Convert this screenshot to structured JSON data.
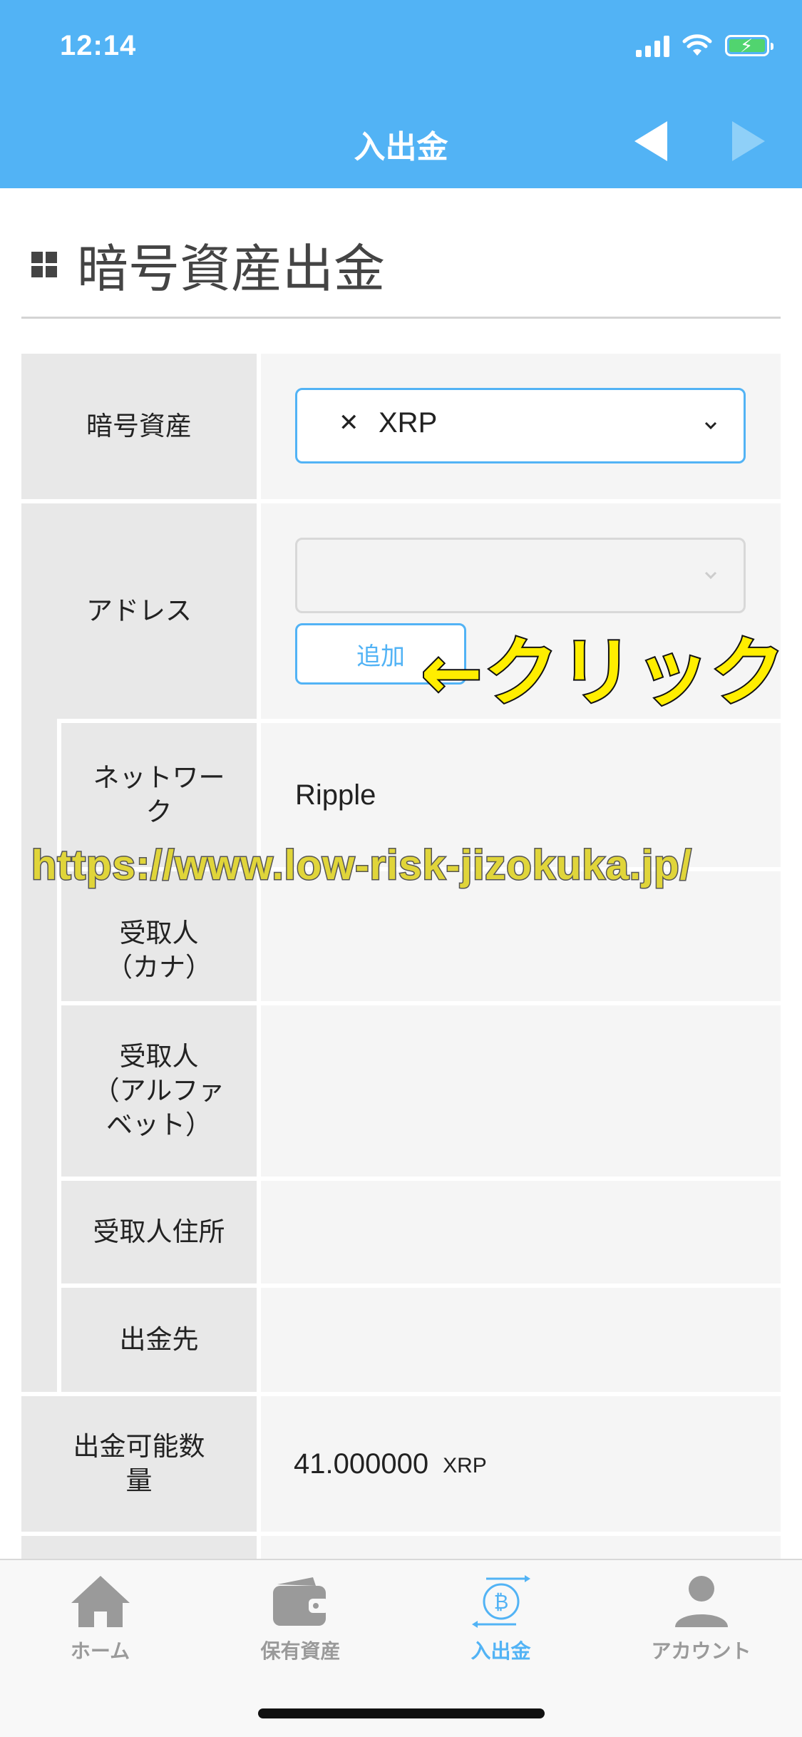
{
  "status_bar": {
    "time": "12:14"
  },
  "header": {
    "title": "入出金"
  },
  "page": {
    "title": "暗号資産出金"
  },
  "form": {
    "crypto_label": "暗号資産",
    "crypto_selected": "XRP",
    "crypto_symbol": "✕",
    "address_label": "アドレス",
    "address_selected": "",
    "add_button": "追加",
    "network_label_line1": "ネットワー",
    "network_label_line2": "ク",
    "network_value": "Ripple",
    "recipient_kana_line1": "受取人",
    "recipient_kana_line2": "（カナ）",
    "recipient_alpha_line1": "受取人",
    "recipient_alpha_line2": "（アルファ",
    "recipient_alpha_line3": "ベット）",
    "recipient_address_label": "受取人住所",
    "destination_label": "出金先",
    "available_label_line1": "出金可能数",
    "available_label_line2": "量",
    "available_value": "41.000000",
    "available_unit": "XRP"
  },
  "annotations": {
    "click": "←クリック",
    "watermark": "https://www.low-risk-jizokuka.jp/"
  },
  "tabbar": {
    "items": [
      {
        "label": "ホーム",
        "icon": "home-icon"
      },
      {
        "label": "保有資産",
        "icon": "wallet-icon"
      },
      {
        "label": "入出金",
        "icon": "bitcoin-transfer-icon",
        "active": true
      },
      {
        "label": "アカウント",
        "icon": "account-icon"
      }
    ]
  },
  "colors": {
    "header_bg": "#52b3f5",
    "accent": "#52b3f5",
    "label_bg": "#e8e8e8",
    "value_bg": "#f5f5f5",
    "annotation": "#ffee00"
  }
}
